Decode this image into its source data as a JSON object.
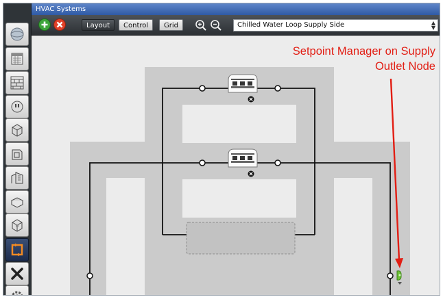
{
  "window": {
    "title": "HVAC Systems"
  },
  "sidebar": {
    "items": [
      {
        "name": "site",
        "icon": "globe-icon"
      },
      {
        "name": "schedules",
        "icon": "calendar-icon"
      },
      {
        "name": "constructions",
        "icon": "bricks-icon"
      },
      {
        "name": "loads",
        "icon": "plug-icon"
      },
      {
        "name": "space-types",
        "icon": "cube-icon"
      },
      {
        "name": "geometry",
        "icon": "building-cube-icon"
      },
      {
        "name": "facility",
        "icon": "building-icon"
      },
      {
        "name": "spaces",
        "icon": "box-icon"
      },
      {
        "name": "thermal-zones",
        "icon": "zone-cube-icon"
      },
      {
        "name": "hvac-systems",
        "icon": "hvac-loop-icon",
        "active": true
      },
      {
        "name": "building-summary",
        "icon": "tools-icon"
      },
      {
        "name": "simulation-settings",
        "icon": "gear-icon"
      }
    ]
  },
  "toolbar": {
    "add_icon": "plus-icon",
    "remove_icon": "x-icon",
    "tabs": [
      {
        "label": "Layout",
        "active": true
      },
      {
        "label": "Control",
        "active": false
      },
      {
        "label": "Grid",
        "active": false
      }
    ],
    "zoom_in_icon": "zoom-in-icon",
    "zoom_out_icon": "zoom-out-icon",
    "loop_select": {
      "value": "Chilled Water Loop Supply Side"
    }
  },
  "diagram": {
    "components": [
      {
        "name": "chiller-1",
        "icon": "chiller-icon",
        "remove_icon": "remove-x-icon"
      },
      {
        "name": "chiller-2",
        "icon": "chiller-icon",
        "remove_icon": "remove-x-icon"
      }
    ],
    "dropzone": {
      "name": "empty-drop-zone"
    },
    "setpoint_manager_icon": "setpoint-manager-icon"
  },
  "annotation": {
    "line1": "Setpoint Manager on Supply",
    "line2": "Outlet Node",
    "color": "#e21e14"
  },
  "colors": {
    "titlebar": "#3c66b0",
    "toolbar": "#3a3e42",
    "canvas": "#ececec",
    "loop_band": "#cbcbcb",
    "arrow": "#e21e14",
    "setpoint_green": "#6fc238"
  }
}
